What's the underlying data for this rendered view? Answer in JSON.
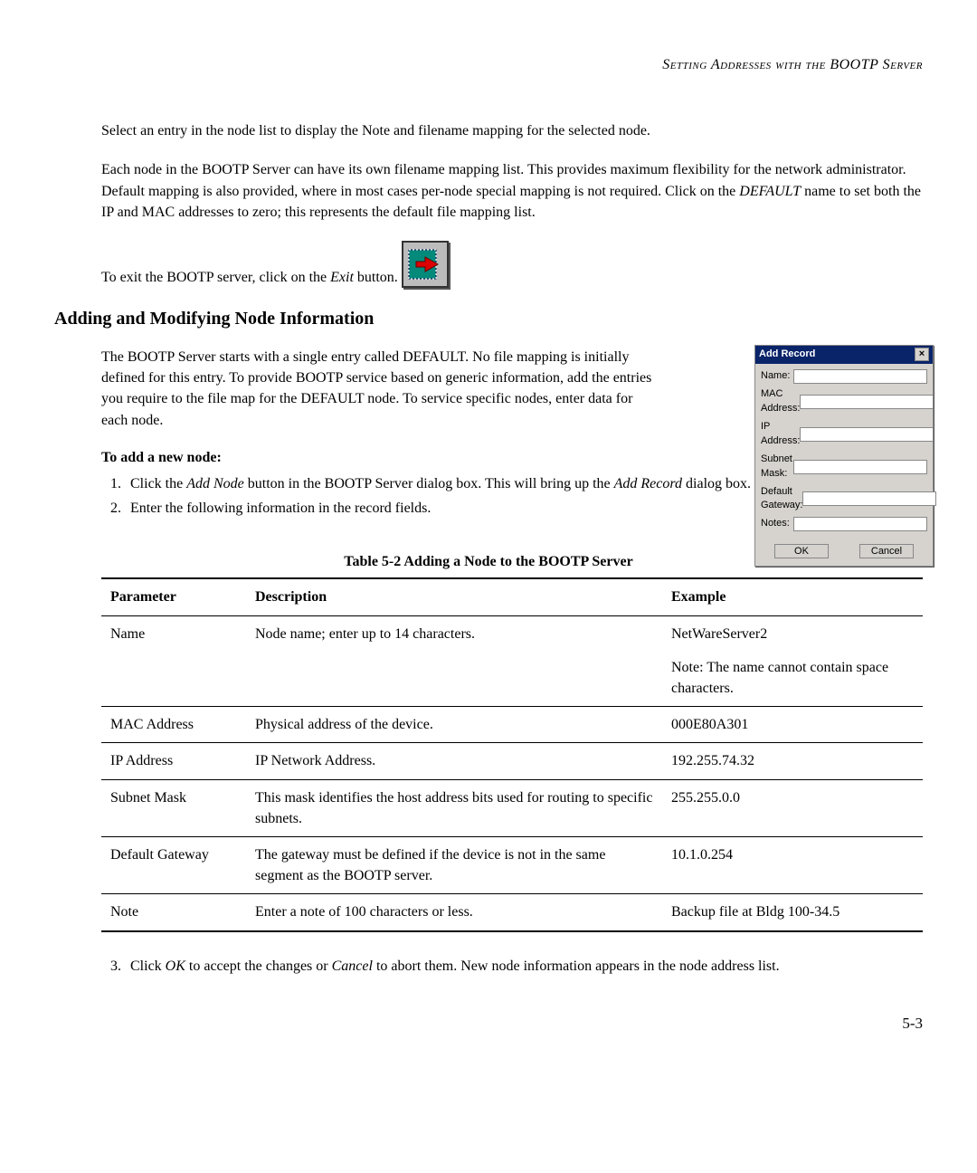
{
  "running_header": "Setting Addresses with the BOOTP Server",
  "para1": "Select an entry in the node list to display the Note and filename mapping for the selected node.",
  "para2_a": "Each node in the BOOTP Server can have its own filename mapping list. This provides maximum flexibility for the network administrator. Default mapping is also provided, where in most cases per-node special mapping is not required. Click on the ",
  "para2_default": "DEFAULT",
  "para2_b": " name to set both the IP and MAC addresses to zero; this represents the default file mapping list.",
  "exit_a": "To exit the BOOTP server, click on the ",
  "exit_btn": "Exit",
  "exit_b": " button.",
  "heading": "Adding and Modifying Node Information",
  "section_para": "The BOOTP Server starts with a single entry called DEFAULT. No file mapping is initially defined for this entry. To provide BOOTP service based on generic information, add the entries you require to the file map for the DEFAULT node. To service specific nodes, enter data for each node.",
  "add_heading": "To add a new node:",
  "steps": {
    "s1a": "Click the ",
    "s1_addnode": "Add Node",
    "s1b": " button in the BOOTP Server dialog box. This will bring up the ",
    "s1_addrecord": "Add Record",
    "s1c": " dialog box.",
    "s2": "Enter the following information in the record fields."
  },
  "dialog": {
    "title": "Add Record",
    "close": "×",
    "fields": {
      "name": "Name:",
      "mac": "MAC Address:",
      "ip": "IP Address:",
      "subnet": "Subnet Mask:",
      "gateway": "Default Gateway:",
      "notes": "Notes:"
    },
    "ok": "OK",
    "cancel": "Cancel"
  },
  "table_caption": "Table 5-2  Adding a Node to the BOOTP Server",
  "table": {
    "headers": {
      "p": "Parameter",
      "d": "Description",
      "e": "Example"
    },
    "rows": [
      {
        "p": "Name",
        "d": "Node name; enter up to 14 characters.",
        "e": "NetWareServer2",
        "e_note": "Note: The name cannot contain space characters."
      },
      {
        "p": "MAC Address",
        "d": "Physical address of the device.",
        "e": "000E80A301"
      },
      {
        "p": "IP Address",
        "d": "IP Network Address.",
        "e": "192.255.74.32"
      },
      {
        "p": "Subnet Mask",
        "d": "This mask identifies the host address bits used for routing to specific subnets.",
        "e": "255.255.0.0"
      },
      {
        "p": "Default Gateway",
        "d": "The gateway must be defined if the device is not in the same segment as the BOOTP server.",
        "e": "10.1.0.254"
      },
      {
        "p": "Note",
        "d": "Enter a note of 100 characters or less.",
        "e": "Backup file at Bldg 100-34.5"
      }
    ]
  },
  "step3_a": "Click ",
  "step3_ok": "OK",
  "step3_b": " to accept the changes or ",
  "step3_cancel": "Cancel",
  "step3_c": " to abort them. New node information appears in the node address list.",
  "page_number": "5-3"
}
